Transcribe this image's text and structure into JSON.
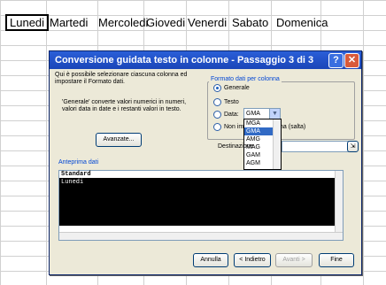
{
  "sheet": {
    "days": [
      "Lunedi",
      "Martedi",
      "Mercoledi",
      "Giovedi",
      "Venerdi",
      "Sabato",
      "Domenica"
    ]
  },
  "dialog": {
    "title": "Conversione guidata testo in colonne - Passaggio 3 di 3",
    "intro": "Qui è possibile selezionare ciascuna colonna ed impostare il Formato dati.",
    "general_note": "'Generale' converte valori numerici in numeri, valori data in date e i restanti valori in testo.",
    "advanced_label": "Avanzate...",
    "format_group_label": "Formato dati per colonna",
    "radios": {
      "general": "Generale",
      "text": "Testo",
      "date": "Data:",
      "skip": "Non importare colonna (salta)"
    },
    "date_value": "GMA",
    "date_options": [
      "MGA",
      "GMA",
      "AMG",
      "MAG",
      "GAM",
      "AGM"
    ],
    "destination_label": "Destinazione",
    "preview_label": "Anteprima dati",
    "preview_header": "Standard",
    "preview_row": "Lunedi",
    "buttons": {
      "cancel": "Annulla",
      "back": "< Indietro",
      "next": "Avanti >",
      "finish": "Fine"
    }
  }
}
